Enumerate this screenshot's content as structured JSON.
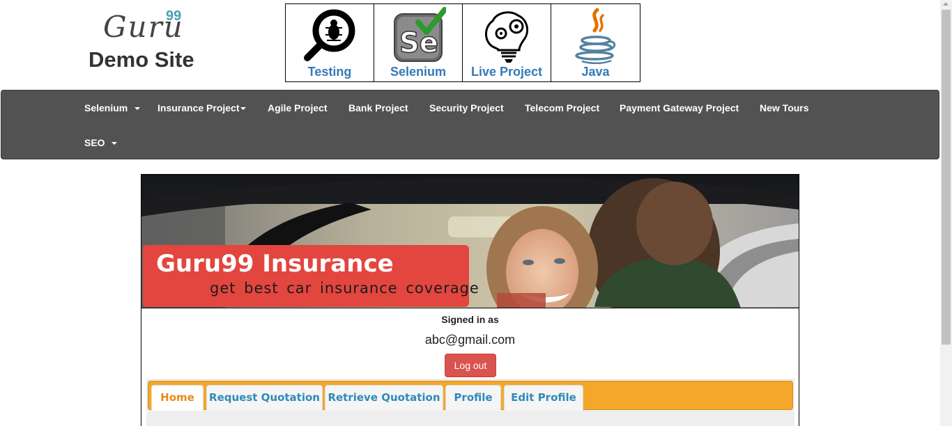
{
  "logo": {
    "guru": "Guru",
    "superscript": "99",
    "subtitle": "Demo Site"
  },
  "top_nav": [
    {
      "label": "Testing",
      "icon": "magnifier-bug-icon"
    },
    {
      "label": "Selenium",
      "icon": "selenium-se-icon"
    },
    {
      "label": "Live Project",
      "icon": "brain-bulb-gears-icon"
    },
    {
      "label": "Java",
      "icon": "java-cup-icon"
    }
  ],
  "navbar": {
    "items": [
      {
        "label": "Selenium ",
        "dropdown": true
      },
      {
        "label": "Insurance Project",
        "dropdown": true
      },
      {
        "label": "Agile Project",
        "dropdown": false
      },
      {
        "label": "Bank Project",
        "dropdown": false
      },
      {
        "label": "Security Project",
        "dropdown": false
      },
      {
        "label": "Telecom Project",
        "dropdown": false
      },
      {
        "label": "Payment Gateway Project",
        "dropdown": false
      },
      {
        "label": "New Tours",
        "dropdown": false
      },
      {
        "label": "SEO ",
        "dropdown": true
      }
    ]
  },
  "banner": {
    "title": "Guru99 Insurance",
    "subtitle": "get best car insurance coverage"
  },
  "account": {
    "signed_in_label": "Signed in as",
    "email": "abc@gmail.com",
    "logout_label": "Log out"
  },
  "tabs": [
    {
      "label": "Home",
      "active": true
    },
    {
      "label": "Request Quotation",
      "active": false
    },
    {
      "label": "Retrieve Quotation",
      "active": false
    },
    {
      "label": "Profile",
      "active": false
    },
    {
      "label": "Edit Profile",
      "active": false
    }
  ],
  "colors": {
    "navbar_bg": "#525252",
    "link_blue": "#337ab7",
    "tab_bar": "#f5a72b",
    "logout_red": "#d9534f",
    "banner_red": "#e2463f"
  }
}
